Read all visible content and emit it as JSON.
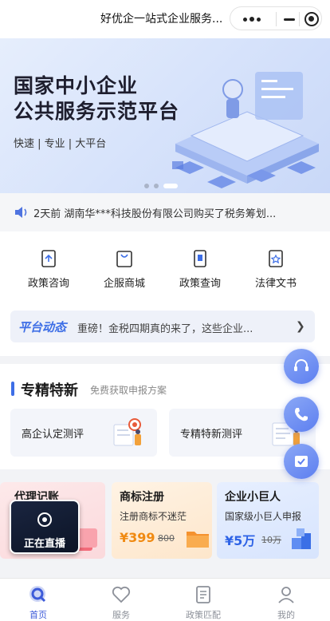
{
  "topbar": {
    "title": "好优企一站式企业服务..."
  },
  "banner": {
    "line1": "国家中小企业",
    "line2": "公共服务示范平台",
    "sub": "快速 | 专业 | 大平台"
  },
  "notice": {
    "text": "2天前 湖南华***科技股份有限公司购买了税务筹划..."
  },
  "quick_links": [
    {
      "label": "政策咨询",
      "icon": "policy-consult-icon"
    },
    {
      "label": "企服商城",
      "icon": "mall-bag-icon"
    },
    {
      "label": "政策查询",
      "icon": "policy-search-icon"
    },
    {
      "label": "法律文书",
      "icon": "legal-doc-icon"
    }
  ],
  "dynamic": {
    "tag": "平台动态",
    "message": "重磅！金税四期真的来了，这些企业..."
  },
  "specialized": {
    "title": "专精特新",
    "hint": "免费获取申报方案",
    "cards": [
      {
        "label": "高企认定测评"
      },
      {
        "label": "专精特新测评"
      }
    ]
  },
  "services": [
    {
      "name": "代理记账",
      "desc": "",
      "price": "",
      "orig": ""
    },
    {
      "name": "商标注册",
      "desc": "注册商标不迷茫",
      "price": "¥399",
      "orig": "800"
    },
    {
      "name": "企业小巨人",
      "desc": "国家级小巨人申报",
      "price": "¥5万",
      "orig": "10万"
    }
  ],
  "live": {
    "label": "正在直播"
  },
  "tabs": [
    {
      "label": "首页",
      "active": true
    },
    {
      "label": "服务",
      "active": false
    },
    {
      "label": "政策匹配",
      "active": false
    },
    {
      "label": "我的",
      "active": false
    }
  ],
  "colors": {
    "accent": "#3d6ee6",
    "price": "#f08a12",
    "tab_active": "#3d5bd9"
  }
}
